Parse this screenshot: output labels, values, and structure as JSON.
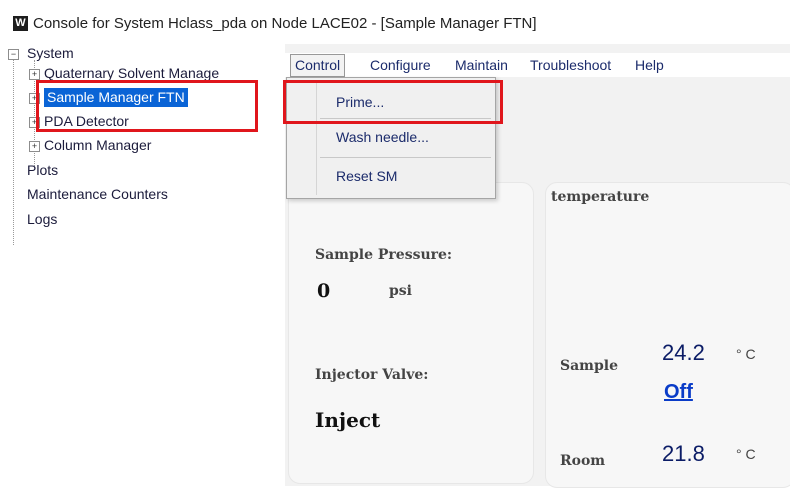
{
  "window": {
    "title": "Console for System Hclass_pda on Node LACE02 - [Sample Manager FTN]",
    "icon_letter": "W"
  },
  "tree": {
    "root": "System",
    "modules": [
      "Quaternary Solvent Manage",
      "Sample Manager FTN",
      "PDA Detector",
      "Column Manager"
    ],
    "items": [
      "Plots",
      "Maintenance Counters",
      "Logs"
    ],
    "expander_glyph": "+",
    "collapse_glyph": "−"
  },
  "menu": {
    "items": [
      "Control",
      "Configure",
      "Maintain",
      "Troubleshoot",
      "Help"
    ]
  },
  "control_dropdown": {
    "items": [
      "Prime...",
      "Wash needle...",
      "Reset SM"
    ]
  },
  "left_panel": {
    "pressure_label": "Sample Pressure:",
    "pressure_value": "0",
    "pressure_unit": "psi",
    "valve_label": "Injector Valve:",
    "valve_value": "Inject"
  },
  "temp_panel": {
    "title": "temperature",
    "sample_label": "Sample",
    "sample_value": "24.2",
    "sample_unit": "° C",
    "sample_state": "Off",
    "room_label": "Room",
    "room_value": "21.8",
    "room_unit": "° C"
  },
  "colors": {
    "selection": "#0a64d6",
    "highlight": "#e0161c",
    "menu_text": "#1b2b6b",
    "value_text": "#0b1c66"
  }
}
